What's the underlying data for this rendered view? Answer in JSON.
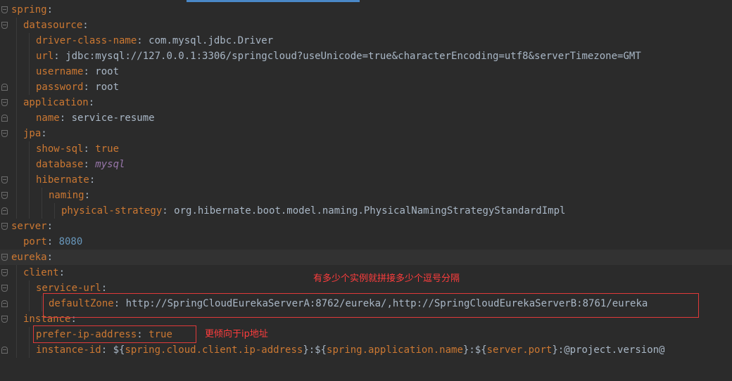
{
  "lines": {
    "l1": {
      "key": "spring",
      "sep": ":"
    },
    "l2": {
      "key": "datasource",
      "sep": ":"
    },
    "l3": {
      "key": "driver-class-name",
      "sep": ": ",
      "value": "com.mysql.jdbc.Driver"
    },
    "l4": {
      "key": "url",
      "sep": ": ",
      "value": "jdbc:mysql://127.0.0.1:3306/springcloud?useUnicode=true&characterEncoding=utf8&serverTimezone=GMT"
    },
    "l5": {
      "key": "username",
      "sep": ": ",
      "value": "root"
    },
    "l6": {
      "key": "password",
      "sep": ": ",
      "value": "root"
    },
    "l7": {
      "key": "application",
      "sep": ":"
    },
    "l8": {
      "key": "name",
      "sep": ": ",
      "value": "service-resume"
    },
    "l9": {
      "key": "jpa",
      "sep": ":"
    },
    "l10": {
      "key": "show-sql",
      "sep": ": ",
      "value": "true"
    },
    "l11": {
      "key": "database",
      "sep": ": ",
      "value": "mysql"
    },
    "l12": {
      "key": "hibernate",
      "sep": ":"
    },
    "l13": {
      "key": "naming",
      "sep": ":"
    },
    "l14": {
      "key": "physical-strategy",
      "sep": ": ",
      "value": "org.hibernate.boot.model.naming.PhysicalNamingStrategyStandardImpl"
    },
    "l15": {
      "key": "server",
      "sep": ":"
    },
    "l16": {
      "key": "port",
      "sep": ": ",
      "value": "8080"
    },
    "l17": {
      "key": "eureka",
      "sep": ":"
    },
    "l18": {
      "key": "client",
      "sep": ":"
    },
    "l19": {
      "key": "service-url",
      "sep": ":"
    },
    "l20": {
      "key": "defaultZone",
      "sep": ": ",
      "value": "http://SpringCloudEurekaServerA:8762/eureka/,http://SpringCloudEurekaServerB:8761/eureka"
    },
    "l21": {
      "key": "instance",
      "sep": ":"
    },
    "l22": {
      "key": "prefer-ip-address",
      "sep": ": ",
      "value": "true"
    },
    "l23": {
      "key": "instance-id",
      "sep": ": ",
      "p1": "${",
      "v1": "spring.cloud.client.ip-address",
      "p2": "}:${",
      "v2": "spring.application.name",
      "p3": "}:${",
      "v3": "server.port",
      "p4": "}:@project.version@"
    }
  },
  "annotations": {
    "note1": "有多少个实例就拼接多少个逗号分隔",
    "note2": "更倾向于ip地址"
  },
  "colors": {
    "background": "#2b2b2b",
    "key": "#cc7832",
    "text": "#a9b7c6",
    "number": "#6897bb",
    "italic_value": "#9876aa",
    "annotation": "#ff3d3d"
  }
}
